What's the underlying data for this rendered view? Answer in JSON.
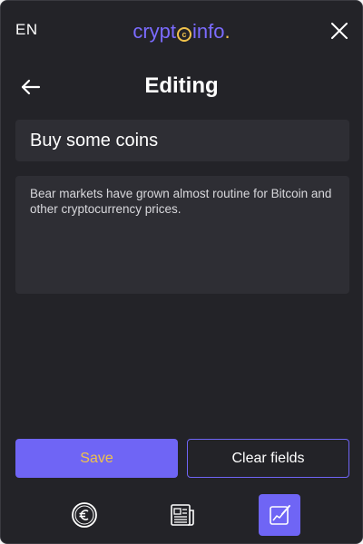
{
  "topbar": {
    "language": "EN",
    "logo": {
      "part1": "crypt",
      "coin_symbol": "c",
      "part2": "info",
      "dot": "."
    }
  },
  "header": {
    "title": "Editing"
  },
  "form": {
    "title_value": "Buy some coins",
    "body_value": "Bear markets have grown almost routine for Bitcoin and other cryptocurrency prices."
  },
  "actions": {
    "save_label": "Save",
    "clear_label": "Clear fields"
  },
  "nav": {
    "items": [
      {
        "icon": "euro-coin-icon",
        "active": false
      },
      {
        "icon": "newspaper-icon",
        "active": false
      },
      {
        "icon": "chart-edit-icon",
        "active": true
      }
    ]
  },
  "colors": {
    "background": "#232328",
    "field": "#2e2e34",
    "accent": "#6f65f5",
    "gold": "#f0c24b"
  }
}
